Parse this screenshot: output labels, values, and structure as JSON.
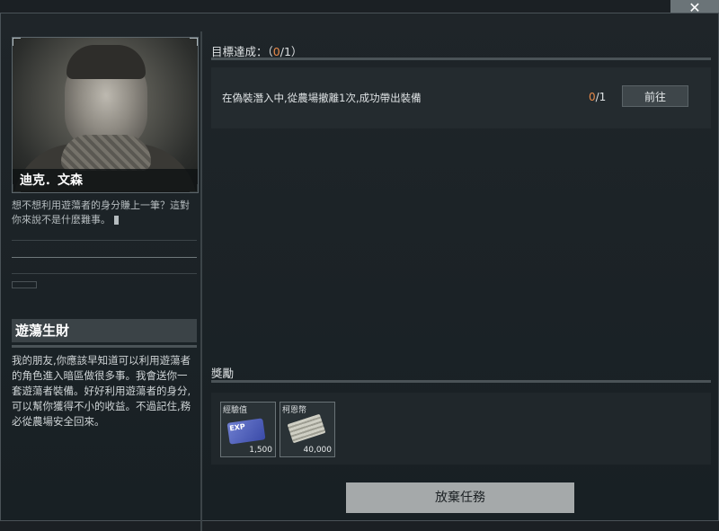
{
  "window": {
    "close_label": "✕"
  },
  "npc": {
    "name": "迪克．文森",
    "quote": "想不想利用遊蕩者的身分賺上一筆？這對你來說不是什麼難事。"
  },
  "task": {
    "title": "遊蕩生財",
    "description": "我的朋友,你應該早知道可以利用遊蕩者的角色進入暗區做很多事。我會送你一套遊蕩者裝備。好好利用遊蕩者的身分,可以幫你獲得不小的收益。不過記住,務必從農場安全回來。"
  },
  "objectives": {
    "label": "目標達成：",
    "done": "0",
    "total": "/1",
    "open_paren": "（",
    "close_paren": "）",
    "items": [
      {
        "text": "在偽裝潛入中,從農場撤離1次,成功帶出裝備",
        "done": "0",
        "total": "/1",
        "button": "前往"
      }
    ]
  },
  "rewards": {
    "label": "獎勵",
    "items": [
      {
        "name": "經驗值",
        "icon": "exp-card-icon",
        "qty": "1,500",
        "badge": "EXP"
      },
      {
        "name": "柯恩幣",
        "icon": "cash-stack-icon",
        "qty": "40,000"
      }
    ]
  },
  "actions": {
    "abandon": "放棄任務"
  },
  "colors": {
    "accent": "#e98a4a",
    "panel": "#242b2f",
    "button": "#a5a9aa"
  }
}
